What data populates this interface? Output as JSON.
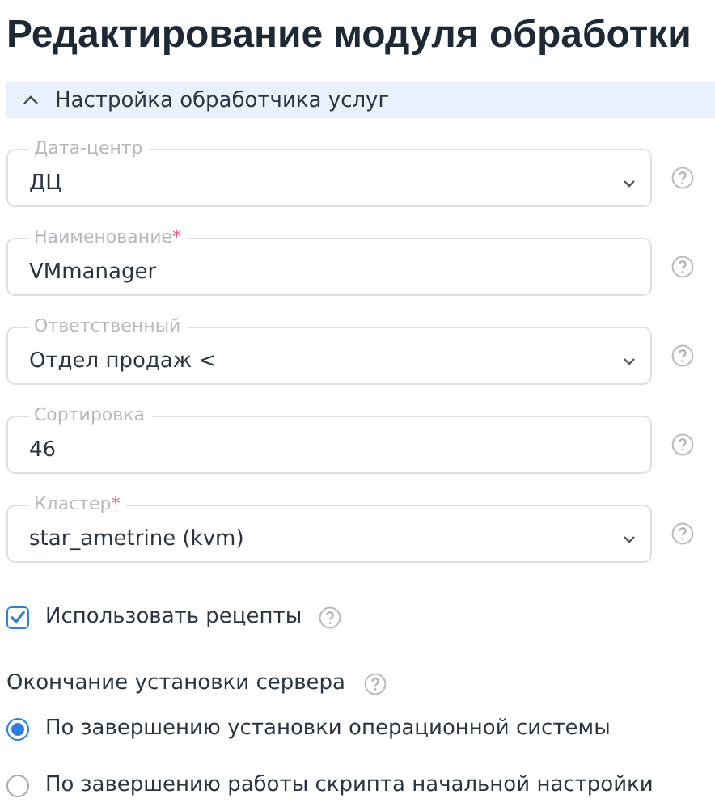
{
  "title": "Редактирование модуля обработки",
  "section": {
    "label": "Настройка обработчика услуг",
    "expanded": true
  },
  "fields": [
    {
      "kind": "select",
      "label": "Дата-центр",
      "value": "ДЦ"
    },
    {
      "kind": "input",
      "label": "Наименование",
      "required_mark": "*",
      "value": "VMmanager"
    },
    {
      "kind": "select",
      "label": "Ответственный",
      "value": "Отдел продаж <"
    },
    {
      "kind": "input",
      "label": "Сортировка",
      "value": "46"
    },
    {
      "kind": "select",
      "label": "Кластер",
      "required_mark": "*",
      "value": "star_ametrine (kvm)"
    }
  ],
  "checkbox": {
    "label": "Использовать рецепты",
    "checked": true
  },
  "radio_group": {
    "label": "Окончание установки сервера",
    "options": [
      {
        "label": "По завершению установки операционной системы",
        "selected": true
      },
      {
        "label": "По завершению работы скрипта начальной настройки",
        "selected": false
      }
    ]
  }
}
